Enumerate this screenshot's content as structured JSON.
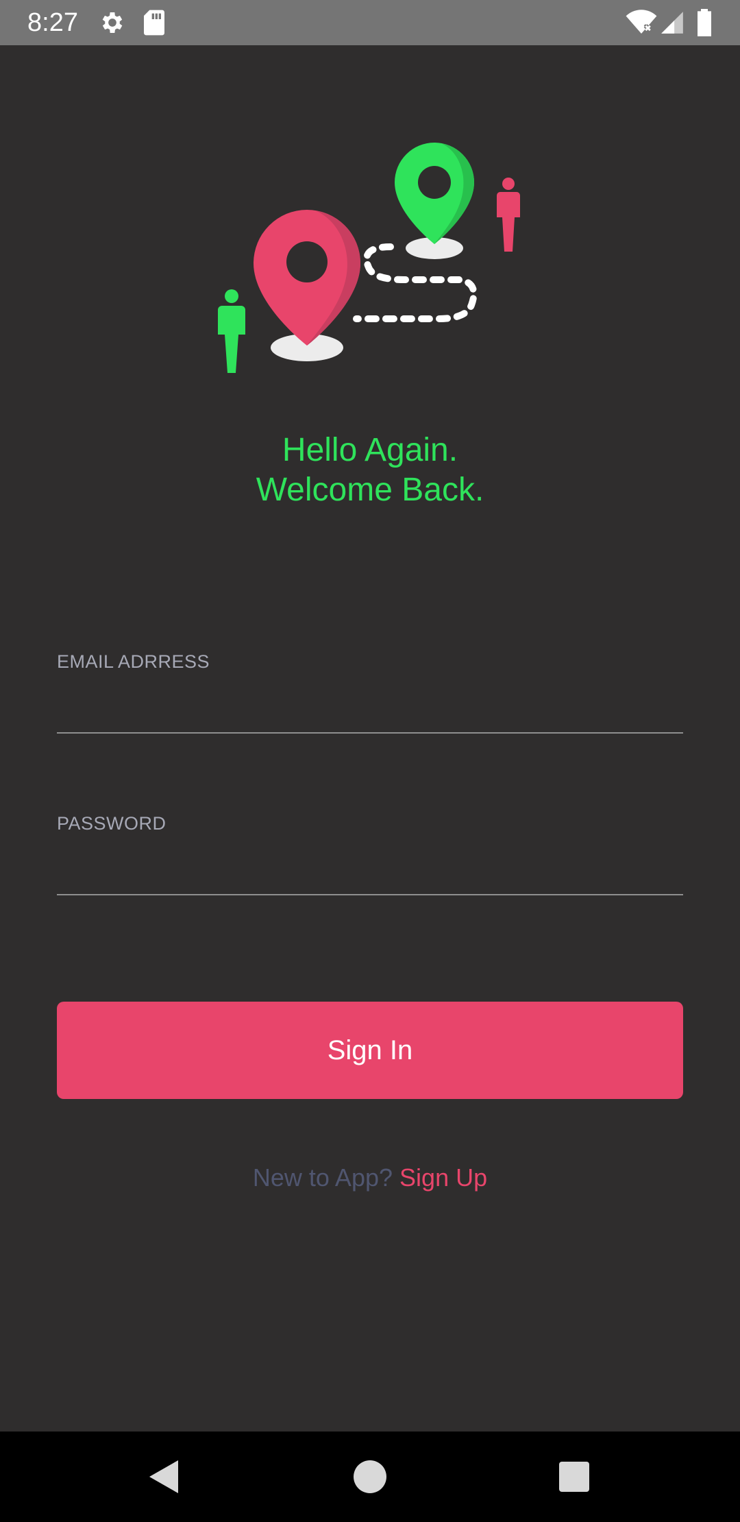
{
  "status_bar": {
    "time": "8:27",
    "icons": [
      "gear-icon",
      "sd-card-icon",
      "wifi-icon",
      "signal-icon",
      "battery-icon"
    ]
  },
  "hero": {
    "icons": [
      "location-pin-pink",
      "location-pin-green",
      "person-green",
      "person-pink",
      "dotted-route"
    ]
  },
  "welcome": {
    "line1": "Hello Again.",
    "line2": "Welcome Back."
  },
  "form": {
    "email_label": "EMAIL ADRRESS",
    "email_value": "",
    "password_label": "PASSWORD",
    "password_value": "",
    "signin_label": "Sign In"
  },
  "signup": {
    "prompt": "New to App?",
    "link": "Sign Up"
  },
  "nav": {
    "icons": [
      "back-icon",
      "home-icon",
      "recents-icon"
    ]
  },
  "colors": {
    "background": "#2f2d2d",
    "accent_green": "#2fe35b",
    "accent_pink": "#e8456b",
    "label_gray": "#a7a9b6",
    "prompt_gray": "#505670"
  }
}
